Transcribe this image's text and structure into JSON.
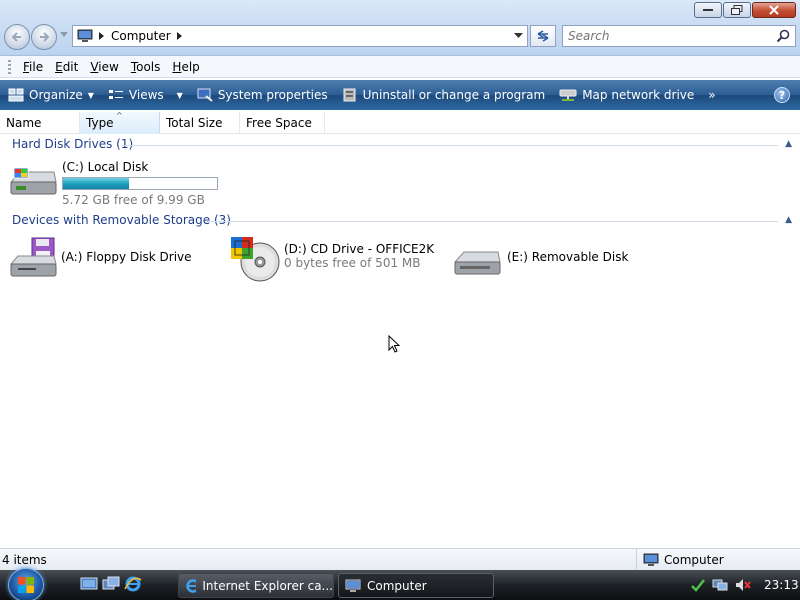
{
  "window": {
    "address_crumb": "Computer",
    "search_placeholder": "Search"
  },
  "menu": [
    "File",
    "Edit",
    "View",
    "Tools",
    "Help"
  ],
  "commands": {
    "organize": "Organize",
    "views": "Views",
    "system_properties": "System properties",
    "uninstall": "Uninstall or change a program",
    "map_drive": "Map network drive",
    "more": "»",
    "help": "?"
  },
  "columns": [
    "Name",
    "Type",
    "Total Size",
    "Free Space"
  ],
  "groups": {
    "hard_disks": {
      "label": "Hard Disk Drives (1)",
      "drives": [
        {
          "name": "(C:) Local Disk",
          "free": "5.72 GB free of 9.99 GB",
          "used_fraction": 0.43
        }
      ]
    },
    "removable": {
      "label": "Devices with Removable Storage (3)",
      "drives": [
        {
          "name": "(A:) Floppy Disk Drive"
        },
        {
          "name": "(D:) CD Drive - OFFICE2K",
          "free": "0 bytes free of 501 MB"
        },
        {
          "name": "(E:) Removable Disk"
        }
      ]
    }
  },
  "status": {
    "items": "4 items",
    "location": "Computer"
  },
  "taskbar": {
    "ie_task": "Internet Explorer ca...",
    "computer_task": "Computer",
    "clock": "23:13"
  },
  "colors": {
    "command_bar": "#2d5f95",
    "group_header": "#1e3e8a",
    "capacity_fill": "#1b9cbc"
  }
}
